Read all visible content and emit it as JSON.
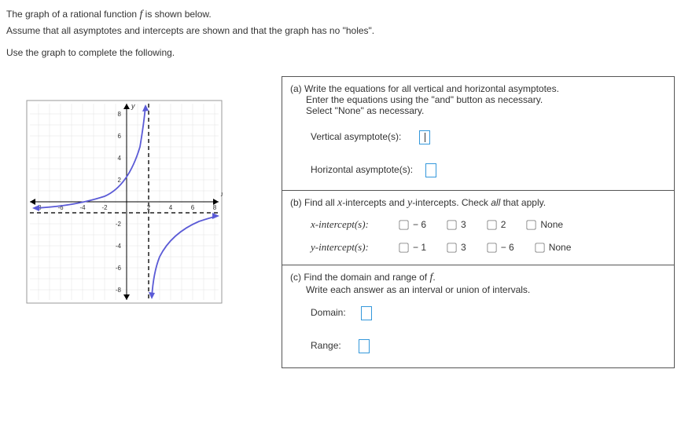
{
  "intro": {
    "line1_pre": "The graph of a rational function ",
    "line1_f": "f",
    "line1_post": " is shown below.",
    "line2": "Assume that all asymptotes and intercepts are shown and that the graph has no \"holes\".",
    "line3": "Use the graph to complete the following."
  },
  "partA": {
    "heading": "(a) Write the equations for all vertical and horizontal asymptotes.",
    "sub1": "Enter the equations using the \"and\" button as necessary.",
    "sub2": "Select \"None\" as necessary.",
    "vert_label": "Vertical asymptote(s):",
    "horiz_label": "Horizontal asymptote(s):"
  },
  "partB": {
    "heading_pre": "(b) Find all ",
    "heading_x": "x",
    "heading_mid": "-intercepts and ",
    "heading_y": "y",
    "heading_post": "-intercepts. Check all that apply.",
    "x_label": "x-intercept(s):",
    "y_label": "y-intercept(s):",
    "x_opts": [
      "− 6",
      "3",
      "2",
      "None"
    ],
    "y_opts": [
      "− 1",
      "3",
      "− 6",
      "None"
    ]
  },
  "partC": {
    "heading_pre": "(c) Find the domain and range of ",
    "heading_f": "f",
    "heading_post": ".",
    "sub": "Write each answer as an interval or union of intervals.",
    "domain_label": "Domain:",
    "range_label": "Range:"
  },
  "chart_data": {
    "type": "line",
    "title": "",
    "xlabel": "x",
    "ylabel": "y",
    "xlim": [
      -8,
      8
    ],
    "ylim": [
      -9,
      9
    ],
    "vertical_asymptote": 2,
    "horizontal_asymptote": -1,
    "series": [
      {
        "name": "left-branch",
        "x": [
          -8,
          -6,
          -4,
          -2,
          0,
          1,
          1.5,
          1.8
        ],
        "y": [
          -0.4,
          -0.25,
          -0.0,
          0.5,
          2.0,
          5.0,
          11.0,
          29.0
        ]
      },
      {
        "name": "right-branch",
        "x": [
          2.2,
          2.5,
          3,
          4,
          6,
          8
        ],
        "y": [
          -31.0,
          -13.0,
          -7.0,
          -4.0,
          -2.5,
          -2.0
        ]
      }
    ]
  }
}
